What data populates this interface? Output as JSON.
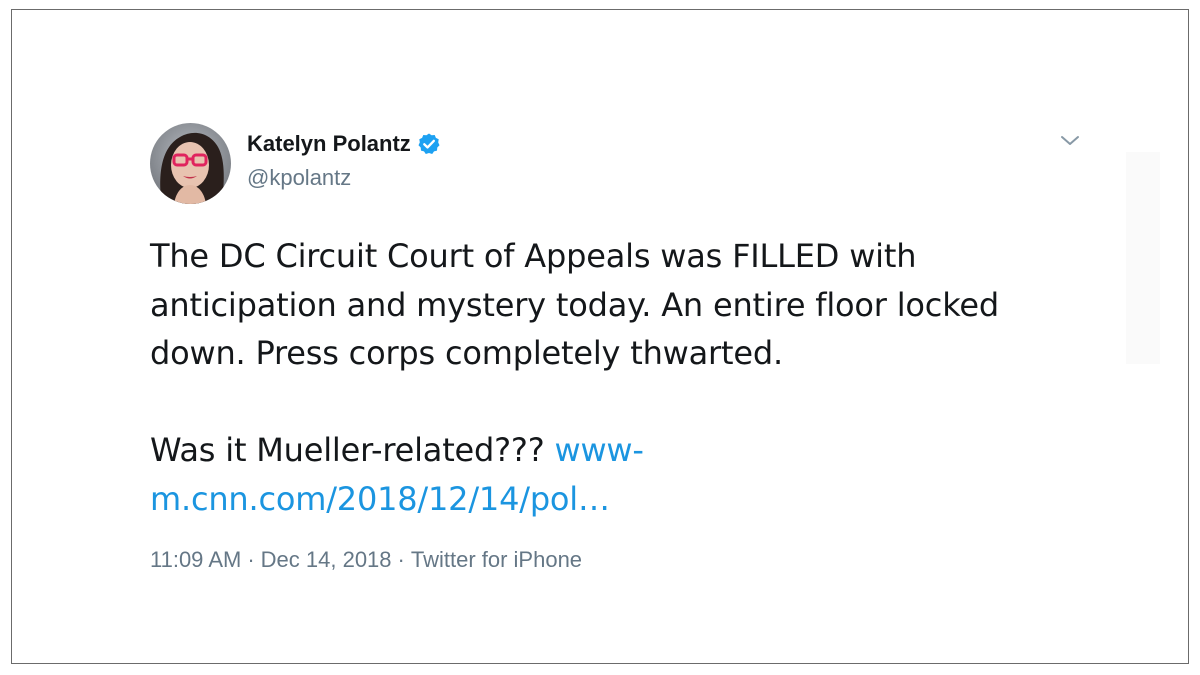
{
  "author": {
    "name": "Katelyn Polantz",
    "handle": "@kpolantz",
    "verified": true
  },
  "tweet": {
    "line1": "The DC Circuit Court of Appeals was FILLED with",
    "line2": "anticipation and mystery today. An entire floor locked",
    "line3": "down. Press corps completely thwarted.",
    "line4_text": "Was it Mueller-related??? ",
    "link_part1": "www-",
    "link_part2": "m.cnn.com/2018/12/14/pol…"
  },
  "meta": {
    "time": "11:09 AM",
    "date": "Dec 14, 2018",
    "source": "Twitter for iPhone",
    "separator": "·"
  },
  "icons": {
    "verified": "verified-badge-icon",
    "caret": "chevron-down-icon"
  },
  "colors": {
    "link": "#1b95e0",
    "verified": "#1da1f2",
    "text": "#14171a",
    "muted": "#657786",
    "frame_border": "#6b6b6b"
  }
}
